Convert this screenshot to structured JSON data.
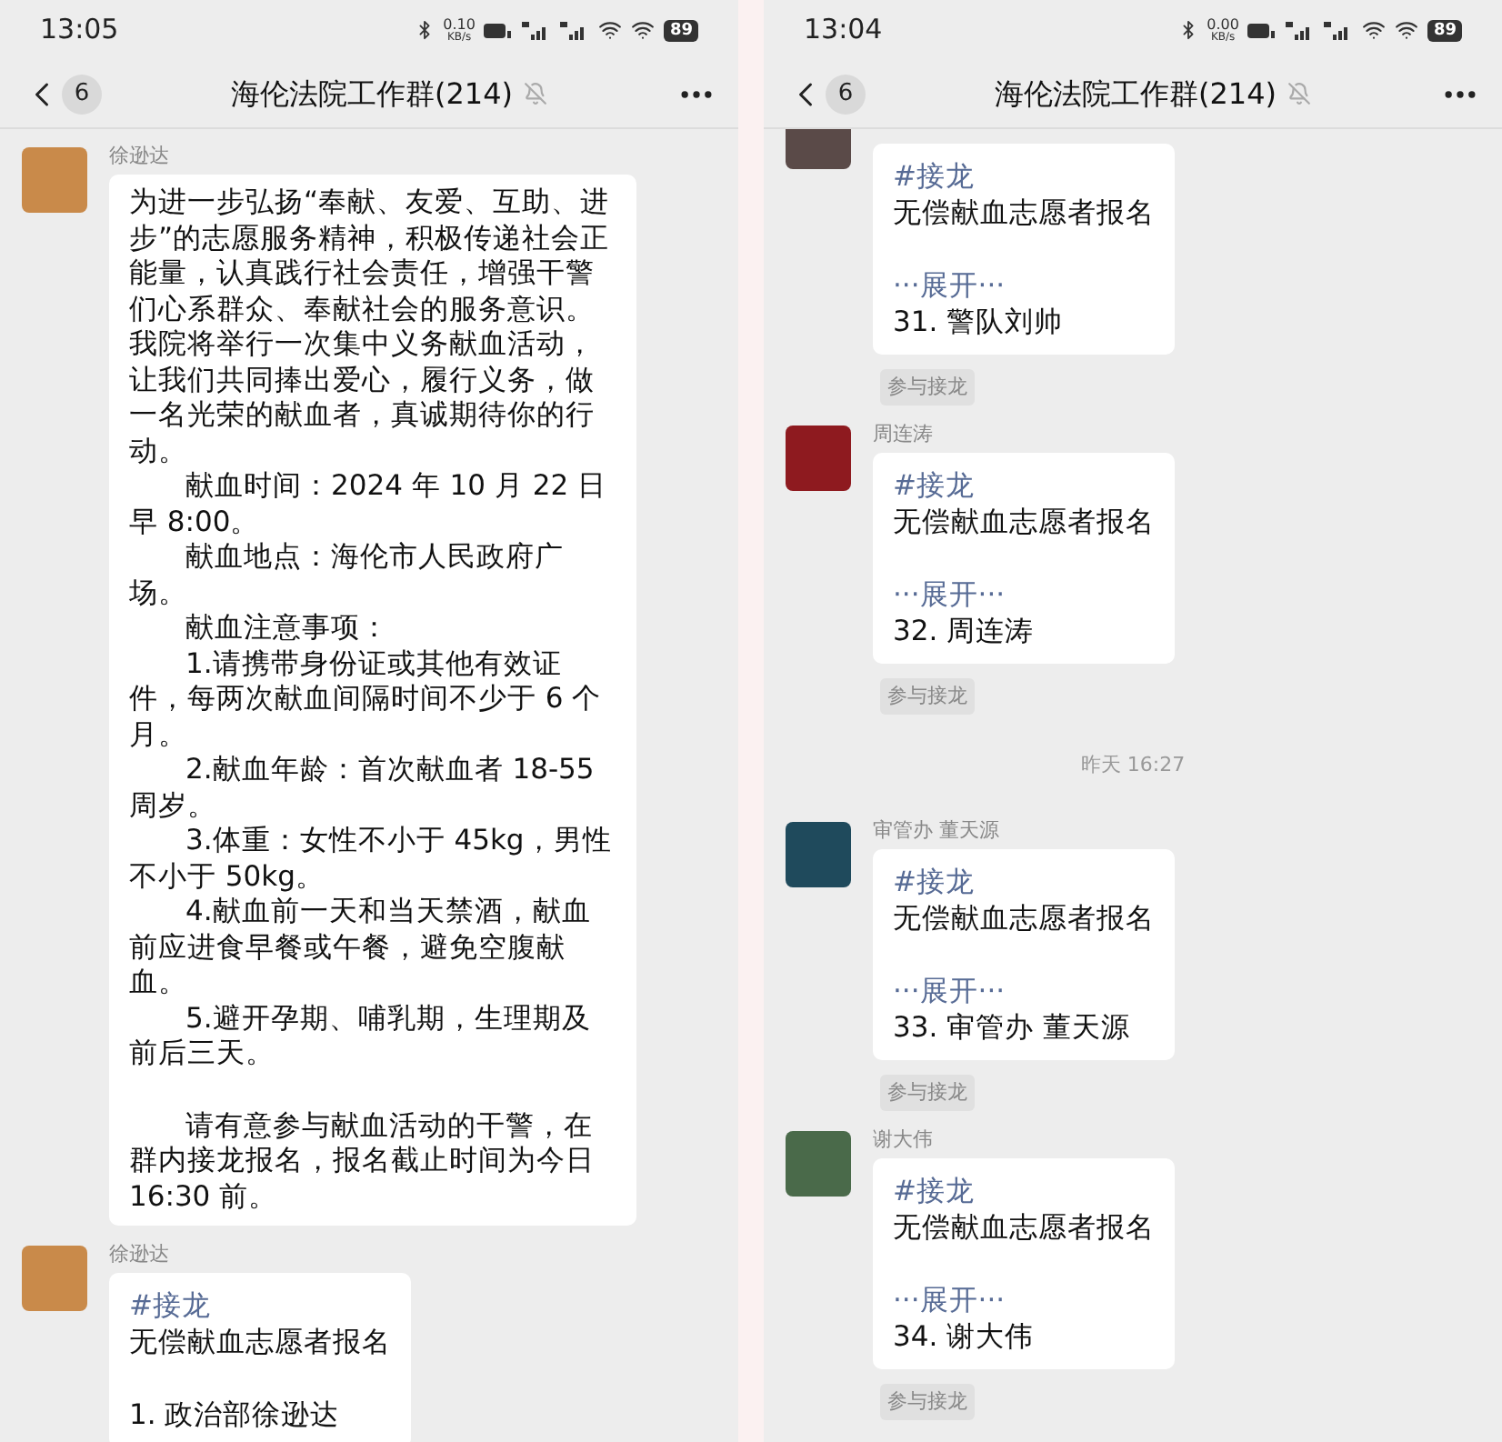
{
  "panels": [
    {
      "status_bar": {
        "time": "13:05",
        "speed_value": "0.10",
        "speed_unit": "KB/s",
        "battery": "89"
      },
      "header": {
        "badge": "6",
        "title": "海伦法院工作群(214)"
      },
      "messages": [
        {
          "kind": "text",
          "sender": "徐逊达",
          "color": "#c98a4a",
          "paragraphs": [
            {
              "text": "为进一步弘扬“奉献、友爱、互助、进步”的志愿服务精神，积极传递社会正能量，认真践行社会责任，增强干警们心系群众、奉献社会的服务意识。我院将举行一次集中义务献血活动，让我们共同捧出爱心，履行义务，做一名光荣的献血者，真诚期待你的行动。",
              "indent": false
            },
            {
              "text": "献血时间：2024 年 10 月 22 日早 8:00。",
              "indent": true
            },
            {
              "text": "献血地点：海伦市人民政府广场。",
              "indent": true
            },
            {
              "text": "献血注意事项：",
              "indent": true
            },
            {
              "text": "1.请携带身份证或其他有效证件，每两次献血间隔时间不少于 6 个月。",
              "indent": true
            },
            {
              "text": "2.献血年龄：首次献血者 18-55 周岁。",
              "indent": true
            },
            {
              "text": "3.体重：女性不小于 45kg，男性不小于 50kg。",
              "indent": true
            },
            {
              "text": "4.献血前一天和当天禁酒，献血前应进食早餐或午餐，避免空腹献血。",
              "indent": true
            },
            {
              "text": "5.避开孕期、哺乳期，生理期及前后三天。",
              "indent": true
            }
          ],
          "closing_paragraphs": [
            {
              "text": "请有意参与献血活动的干警，在群内接龙报名，报名截止时间为今日 16:30 前。",
              "indent": true
            }
          ]
        },
        {
          "kind": "solitaire",
          "sender": "徐逊达",
          "color": "#c98a4a",
          "tag": "#接龙",
          "title": "无偿献血志愿者报名",
          "entry": "1. 政治部徐逊达"
        }
      ]
    },
    {
      "status_bar": {
        "time": "13:04",
        "speed_value": "0.00",
        "speed_unit": "KB/s",
        "battery": "89"
      },
      "header": {
        "badge": "6",
        "title": "海伦法院工作群(214)"
      },
      "messages": [
        {
          "kind": "solitaire",
          "color": "#5a4a48",
          "tag": "#接龙",
          "title": "无偿献血志愿者报名",
          "expand": "···展开···",
          "entry": "31. 警队刘帅",
          "join": "参与接龙"
        },
        {
          "kind": "solitaire",
          "sender": "周连涛",
          "color": "#8e1a1f",
          "tag": "#接龙",
          "title": "无偿献血志愿者报名",
          "expand": "···展开···",
          "entry": "32. 周连涛",
          "join": "参与接龙"
        },
        {
          "kind": "time",
          "text": "昨天 16:27"
        },
        {
          "kind": "solitaire",
          "sender": "审管办 董天源",
          "color": "#1f4a5c",
          "tag": "#接龙",
          "title": "无偿献血志愿者报名",
          "expand": "···展开···",
          "entry": "33. 审管办 董天源",
          "join": "参与接龙"
        },
        {
          "kind": "solitaire",
          "sender": "谢大伟",
          "color": "#4a6a4a",
          "tag": "#接龙",
          "title": "无偿献血志愿者报名",
          "expand": "···展开···",
          "entry": "34. 谢大伟",
          "join": "参与接龙"
        }
      ]
    }
  ]
}
